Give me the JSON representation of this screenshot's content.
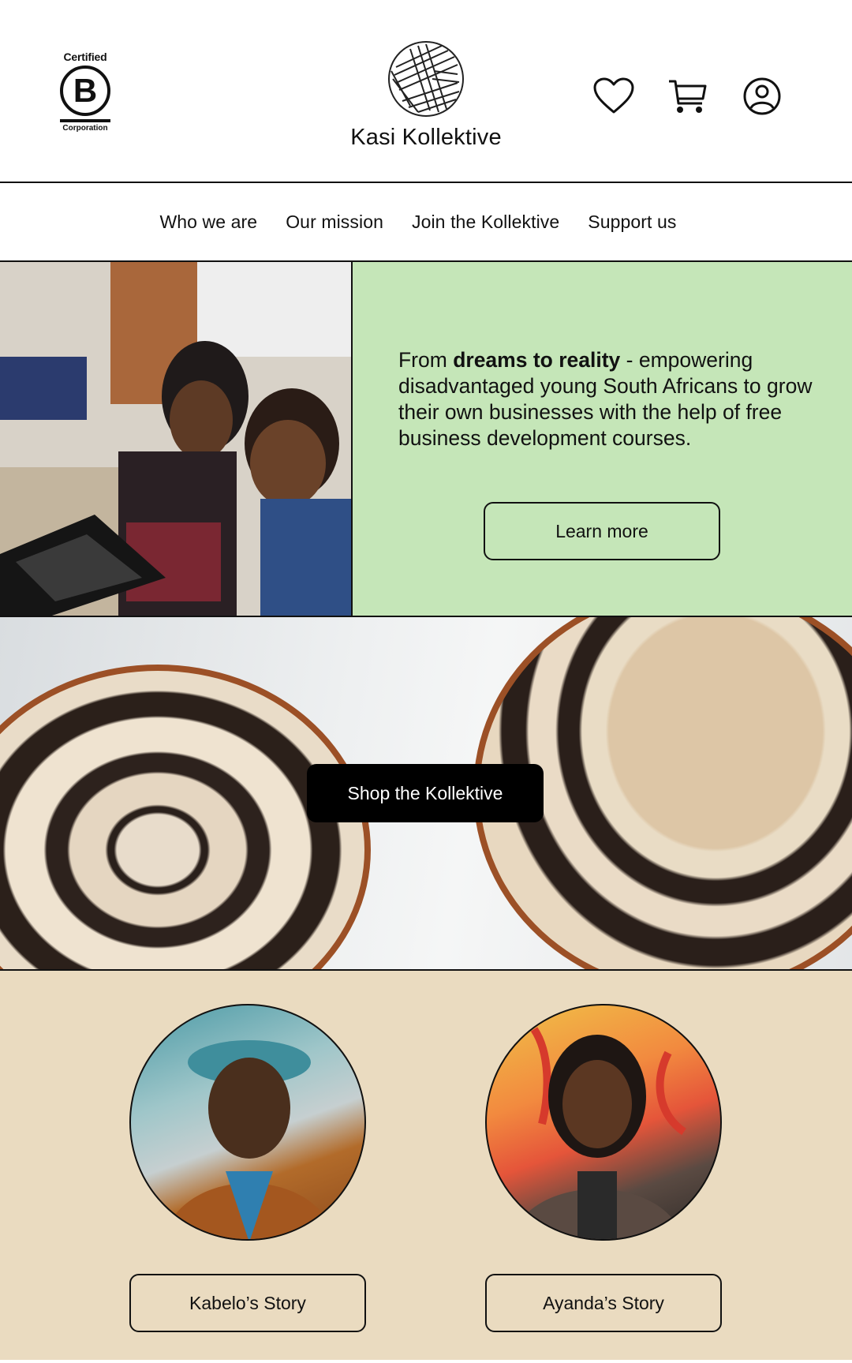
{
  "header": {
    "bcorp": {
      "certified": "Certified",
      "letter": "B",
      "corporation": "Corporation"
    },
    "brand_name": "Kasi Kollektive",
    "icons": [
      "heart-icon",
      "cart-icon",
      "user-icon"
    ]
  },
  "nav": {
    "items": [
      {
        "label": "Who we are"
      },
      {
        "label": "Our mission"
      },
      {
        "label": "Join the Kollektive"
      },
      {
        "label": "Support us"
      }
    ]
  },
  "hero": {
    "text_prefix": "From ",
    "text_bold": "dreams to reality",
    "text_suffix": " - empowering disadvantaged young South Africans to grow their own businesses with the help of free business development courses.",
    "cta": "Learn more",
    "bg_color": "#c5e6b8"
  },
  "shop": {
    "cta": "Shop the Kollektive"
  },
  "stories": {
    "bg_color": "#eadbc0",
    "items": [
      {
        "label": "Kabelo’s Story"
      },
      {
        "label": "Ayanda’s Story"
      }
    ]
  }
}
